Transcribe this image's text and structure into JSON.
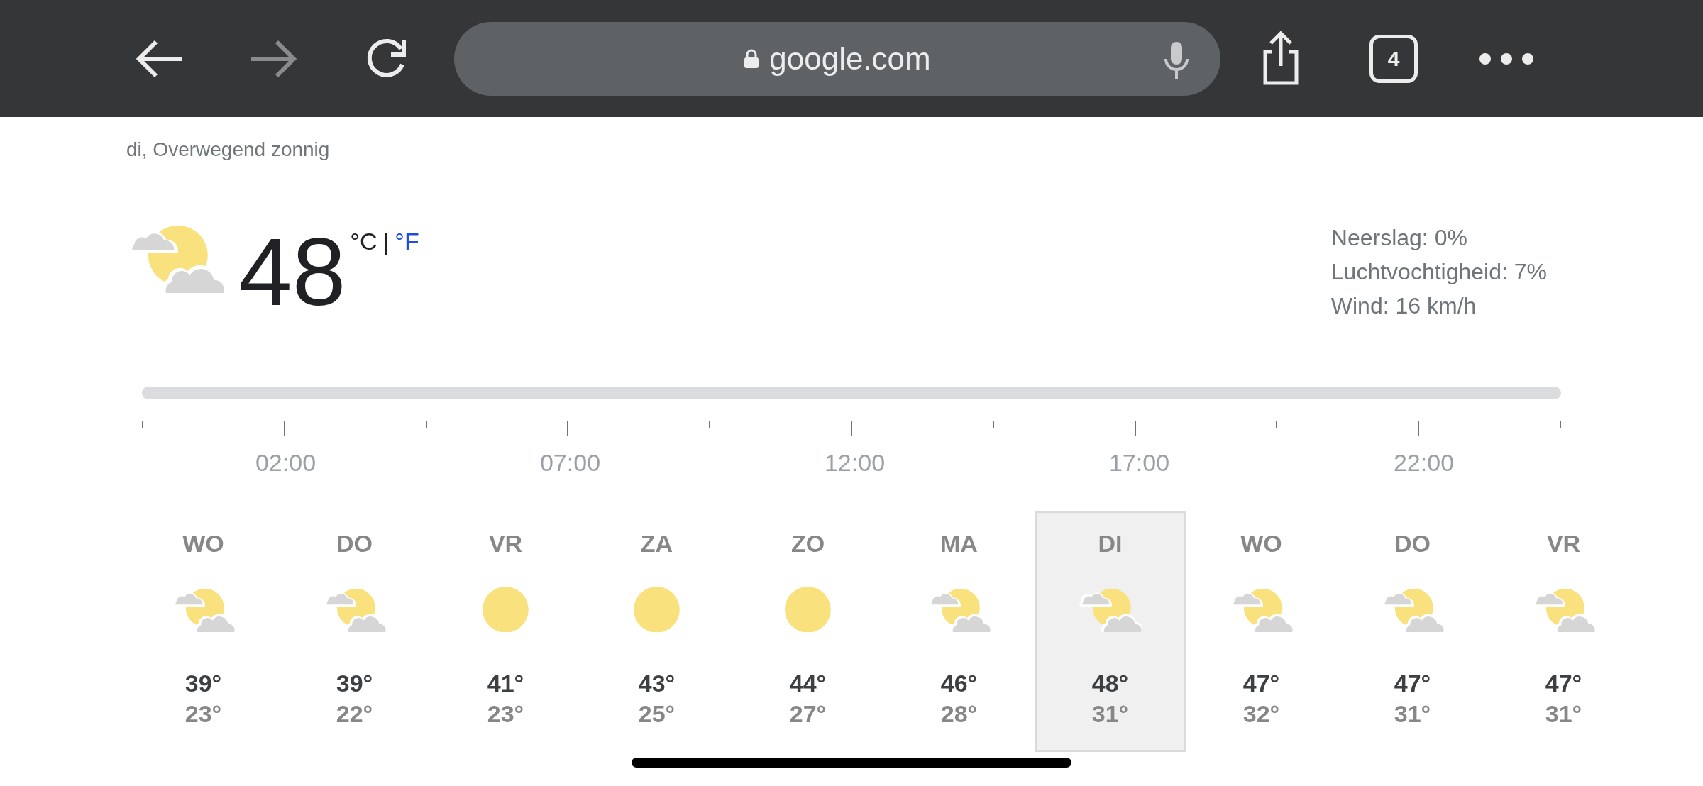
{
  "browser": {
    "url": "google.com",
    "tab_count": "4"
  },
  "subtitle": "di, Overwegend zonnig",
  "current": {
    "kind": "partly_cloudy",
    "temperature": "48",
    "units": [
      {
        "label": "°C",
        "selected": true
      },
      {
        "label": "°F",
        "selected": false
      }
    ],
    "separator": "|"
  },
  "details": [
    "Neerslag: 0%",
    "Luchtvochtigheid: 7%",
    "Wind: 16 km/h"
  ],
  "timeline": {
    "labels": [
      "02:00",
      "07:00",
      "12:00",
      "17:00",
      "22:00"
    ]
  },
  "days": [
    {
      "day": "WO",
      "kind": "partly_cloudy",
      "high": "39°",
      "low": "23°",
      "selected": false
    },
    {
      "day": "DO",
      "kind": "partly_cloudy",
      "high": "39°",
      "low": "22°",
      "selected": false
    },
    {
      "day": "VR",
      "kind": "sunny",
      "high": "41°",
      "low": "23°",
      "selected": false
    },
    {
      "day": "ZA",
      "kind": "sunny",
      "high": "43°",
      "low": "25°",
      "selected": false
    },
    {
      "day": "ZO",
      "kind": "sunny",
      "high": "44°",
      "low": "27°",
      "selected": false
    },
    {
      "day": "MA",
      "kind": "partly_cloudy",
      "high": "46°",
      "low": "28°",
      "selected": false
    },
    {
      "day": "DI",
      "kind": "partly_cloudy",
      "high": "48°",
      "low": "31°",
      "selected": true
    },
    {
      "day": "WO",
      "kind": "partly_cloudy",
      "high": "47°",
      "low": "32°",
      "selected": false
    },
    {
      "day": "DO",
      "kind": "partly_cloudy",
      "high": "47°",
      "low": "31°",
      "selected": false
    },
    {
      "day": "VR",
      "kind": "partly_cloudy",
      "high": "47°",
      "low": "31°",
      "selected": false
    }
  ]
}
